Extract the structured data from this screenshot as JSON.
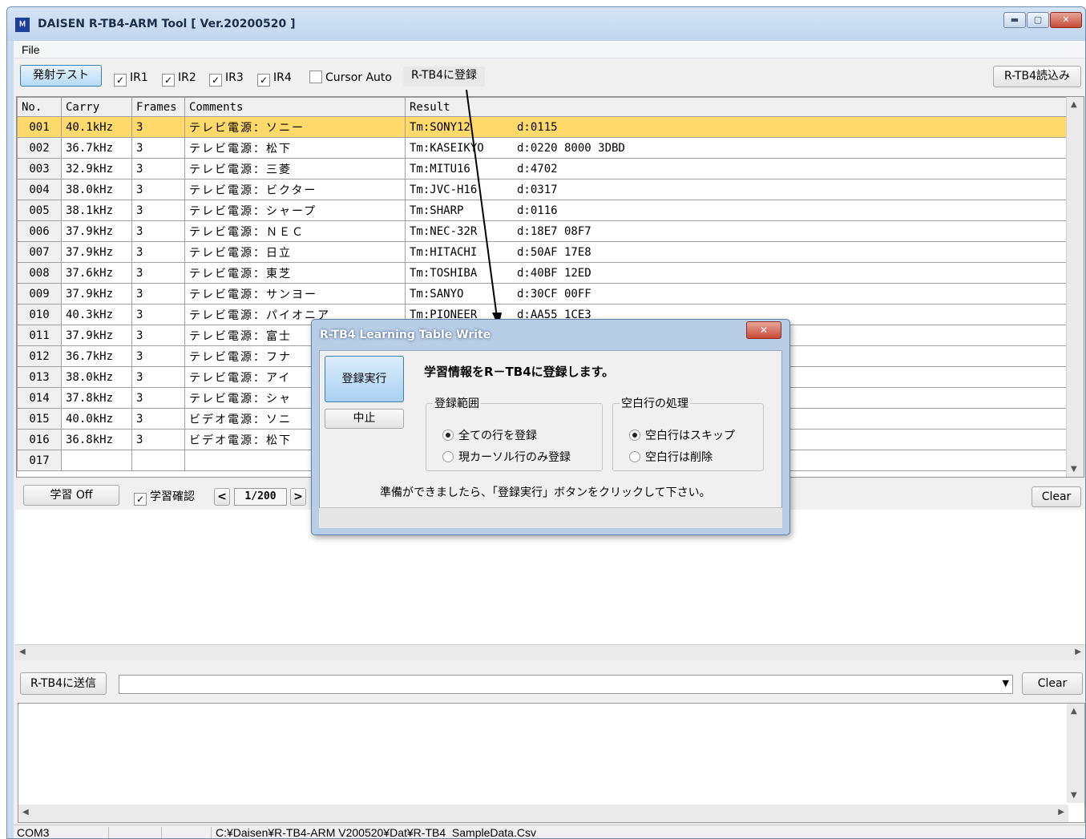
{
  "window": {
    "app_icon_text": "Ｍ",
    "title": "DAISEN R-TB4-ARM Tool [ Ver.20200520 ]",
    "min_symbol": "▬",
    "max_symbol": "▢",
    "close_symbol": "✕"
  },
  "menu": {
    "file": "File"
  },
  "toolbar": {
    "hassha_label": "発射テスト",
    "ir1": "IR1",
    "ir2": "IR2",
    "ir3": "IR3",
    "ir4": "IR4",
    "cursor_auto": "Cursor Auto",
    "register_label": "R-TB4に登録",
    "read_label": "R-TB4読込み",
    "check_mark": "✓"
  },
  "grid": {
    "headers": {
      "no": "No.",
      "carry": "Carry",
      "frames": "Frames",
      "comments": "Comments",
      "result": "Result"
    },
    "rows": [
      {
        "no": "001",
        "carry": "40.1kHz",
        "frames": "3",
        "comment": "テレビ電源：ソニー",
        "tm": "Tm:SONY12",
        "d": "d:0115"
      },
      {
        "no": "002",
        "carry": "36.7kHz",
        "frames": "3",
        "comment": "テレビ電源：松下",
        "tm": "Tm:KASEIKYO",
        "d": "d:0220 8000 3DBD"
      },
      {
        "no": "003",
        "carry": "32.9kHz",
        "frames": "3",
        "comment": "テレビ電源：三菱",
        "tm": "Tm:MITU16",
        "d": "d:4702"
      },
      {
        "no": "004",
        "carry": "38.0kHz",
        "frames": "3",
        "comment": "テレビ電源：ビクター",
        "tm": "Tm:JVC-H16",
        "d": "d:0317"
      },
      {
        "no": "005",
        "carry": "38.1kHz",
        "frames": "3",
        "comment": "テレビ電源：シャープ",
        "tm": "Tm:SHARP",
        "d": "d:0116"
      },
      {
        "no": "006",
        "carry": "37.9kHz",
        "frames": "3",
        "comment": "テレビ電源：ＮＥＣ",
        "tm": "Tm:NEC-32R",
        "d": "d:18E7 08F7"
      },
      {
        "no": "007",
        "carry": "37.9kHz",
        "frames": "3",
        "comment": "テレビ電源：日立",
        "tm": "Tm:HITACHI",
        "d": "d:50AF 17E8"
      },
      {
        "no": "008",
        "carry": "37.6kHz",
        "frames": "3",
        "comment": "テレビ電源：東芝",
        "tm": "Tm:TOSHIBA",
        "d": "d:40BF 12ED"
      },
      {
        "no": "009",
        "carry": "37.9kHz",
        "frames": "3",
        "comment": "テレビ電源：サンヨー",
        "tm": "Tm:SANYO",
        "d": "d:30CF 00FF"
      },
      {
        "no": "010",
        "carry": "40.3kHz",
        "frames": "3",
        "comment": "テレビ電源：パイオニア",
        "tm": "Tm:PIONEER",
        "d": "d:AA55 1CE3"
      },
      {
        "no": "011",
        "carry": "37.9kHz",
        "frames": "3",
        "comment": "テレビ電源：富士",
        "tm": "",
        "d": ""
      },
      {
        "no": "012",
        "carry": "36.7kHz",
        "frames": "3",
        "comment": "テレビ電源：フナ",
        "tm": "",
        "d": ""
      },
      {
        "no": "013",
        "carry": "38.0kHz",
        "frames": "3",
        "comment": "テレビ電源：アイ",
        "tm": "",
        "d": ""
      },
      {
        "no": "014",
        "carry": "37.8kHz",
        "frames": "3",
        "comment": "テレビ電源：シャ",
        "tm": "",
        "d": ""
      },
      {
        "no": "015",
        "carry": "40.0kHz",
        "frames": "3",
        "comment": "ビデオ電源：ソニ",
        "tm": "",
        "d": ""
      },
      {
        "no": "016",
        "carry": "36.8kHz",
        "frames": "3",
        "comment": "ビデオ電源：松下",
        "tm": "",
        "d": ""
      },
      {
        "no": "017",
        "carry": "",
        "frames": "",
        "comment": "",
        "tm": "",
        "d": ""
      }
    ]
  },
  "learn": {
    "toggle_label": "学習 Off",
    "confirm_label": "学習確認",
    "prev": "<",
    "page": "1/200",
    "next": ">",
    "clear_label": "Clear"
  },
  "send": {
    "send_label": "R-TB4に送信",
    "combo_value": "",
    "clear_label": "Clear"
  },
  "status": {
    "port": "COM3",
    "path": "C:¥Daisen¥R-TB4-ARM V200520¥Dat¥R-TB4_SampleData.Csv"
  },
  "dialog": {
    "title": "R-TB4 Learning Table Write",
    "close_symbol": "✕",
    "exec_label": "登録実行",
    "abort_label": "中止",
    "message": "学習情報をR－TB4に登録します。",
    "range_legend": "登録範囲",
    "range_all": "全ての行を登録",
    "range_cursor": "現カーソル行のみ登録",
    "blank_legend": "空白行の処理",
    "blank_skip": "空白行はスキップ",
    "blank_delete": "空白行は削除",
    "hint": "準備ができましたら、「登録実行」ボタンをクリックして下さい。"
  },
  "colors": {
    "selected_row": "#ffd96a",
    "title_bar": "#c9dcef",
    "accent_button": "#b5dbf5"
  }
}
